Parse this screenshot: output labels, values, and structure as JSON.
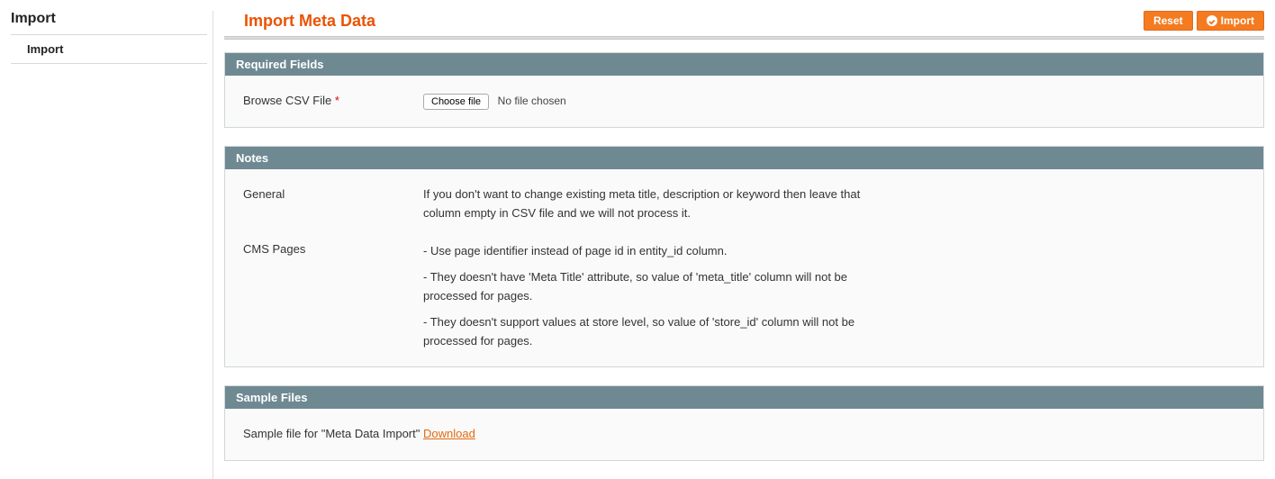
{
  "sidebar": {
    "title": "Import",
    "subitem": "Import"
  },
  "page": {
    "title": "Import Meta Data"
  },
  "buttons": {
    "reset": "Reset",
    "import": "Import"
  },
  "sections": {
    "required_fields": {
      "header": "Required Fields",
      "browse_label": "Browse CSV File",
      "choose_file_btn": "Choose file",
      "no_file_text": "No file chosen"
    },
    "notes": {
      "header": "Notes",
      "general_label": "General",
      "general_text": "If you don't want to change existing meta title, description or keyword then leave that column empty in CSV file and we will not process it.",
      "cms_label": "CMS Pages",
      "cms_b1": "- Use page identifier instead of page id in entity_id column.",
      "cms_b2": "- They doesn't have 'Meta Title' attribute, so value of 'meta_title' column will not be processed for pages.",
      "cms_b3": "- They doesn't support values at store level, so value of 'store_id' column will not be processed for pages."
    },
    "sample_files": {
      "header": "Sample Files",
      "label": "Sample file for \"Meta Data Import\"",
      "download": "Download"
    }
  }
}
